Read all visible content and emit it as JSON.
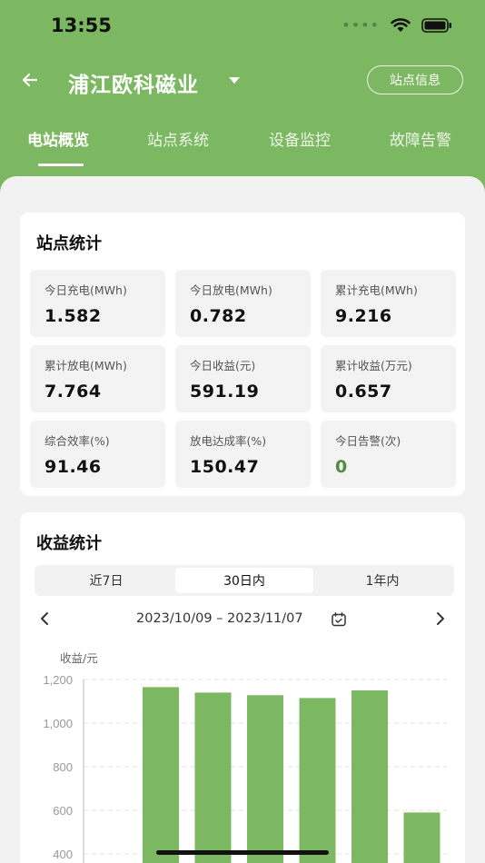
{
  "status_bar": {
    "time": "13:55"
  },
  "header": {
    "station_name": "浦江欧科磁业",
    "info_button": "站点信息"
  },
  "tabs": [
    {
      "label": "电站概览",
      "active": true
    },
    {
      "label": "站点系统",
      "active": false
    },
    {
      "label": "设备监控",
      "active": false
    },
    {
      "label": "故障告警",
      "active": false
    }
  ],
  "stats": {
    "title": "站点统计",
    "items": [
      {
        "label": "今日充电(MWh)",
        "value": "1.582"
      },
      {
        "label": "今日放电(MWh)",
        "value": "0.782"
      },
      {
        "label": "累计充电(MWh)",
        "value": "9.216"
      },
      {
        "label": "累计放电(MWh)",
        "value": "7.764"
      },
      {
        "label": "今日收益(元)",
        "value": "591.19"
      },
      {
        "label": "累计收益(万元)",
        "value": "0.657"
      },
      {
        "label": "综合效率(%)",
        "value": "91.46"
      },
      {
        "label": "放电达成率(%)",
        "value": "150.47"
      },
      {
        "label": "今日告警(次)",
        "value": "0",
        "highlight": true
      }
    ]
  },
  "revenue": {
    "title": "收益统计",
    "periods": [
      {
        "label": "近7日",
        "active": false
      },
      {
        "label": "30日内",
        "active": true
      },
      {
        "label": "1年内",
        "active": false
      }
    ],
    "date_range": "2023/10/09 – 2023/11/07"
  },
  "colors": {
    "accent": "#7cb861",
    "bar": "#7cb861",
    "alarm_zero": "#4f8f3c"
  },
  "chart_data": {
    "type": "bar",
    "title": "",
    "xlabel": "",
    "ylabel": "收益/元",
    "ylim": [
      400,
      1200
    ],
    "yticks": [
      1200,
      1000,
      800,
      600,
      400
    ],
    "ytick_labels": [
      "1,200",
      "1,000",
      "800",
      "600",
      "400"
    ],
    "grid": true,
    "values": [
      1165,
      1140,
      1128,
      1115,
      1150,
      590
    ]
  }
}
